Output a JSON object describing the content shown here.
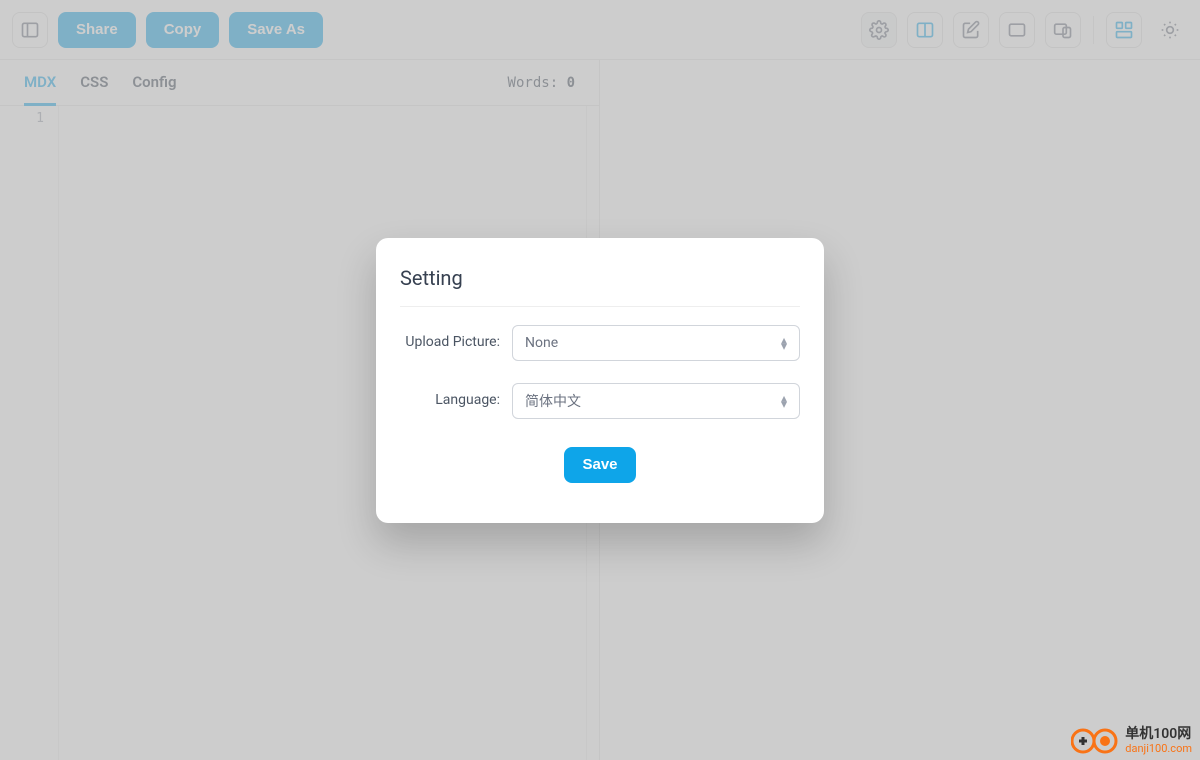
{
  "toolbar": {
    "share_label": "Share",
    "copy_label": "Copy",
    "save_as_label": "Save As"
  },
  "tabs": {
    "mdx": "MDX",
    "css": "CSS",
    "config": "Config"
  },
  "wordcount": {
    "label": "Words: ",
    "value": "0"
  },
  "gutter": {
    "line1": "1"
  },
  "modal": {
    "title": "Setting",
    "upload_label": "Upload Picture:",
    "upload_value": "None",
    "language_label": "Language:",
    "language_value": "简体中文",
    "save_label": "Save"
  },
  "watermark": {
    "line1": "单机100网",
    "line2": "danji100.com"
  }
}
